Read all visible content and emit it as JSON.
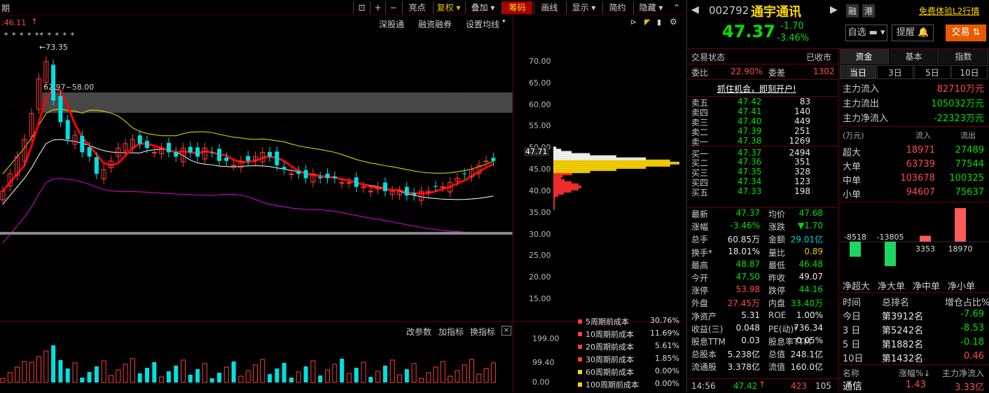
{
  "toolbar": {
    "period_left": "期",
    "buttons": [
      "亮点",
      "复权",
      "叠加",
      "筹码",
      "画线",
      "显示",
      "简约",
      "隐藏"
    ],
    "icons": [
      "lock-icon",
      "plus-icon",
      "minus-icon"
    ]
  },
  "chart_header": {
    "price_left": ":46.11",
    "marks": "* *  *   *  ** *  *   *   *",
    "links": [
      "深股通",
      "融资融券",
      "设置均线"
    ],
    "high_label": "73.35",
    "zone_label": "62.97~58.00"
  },
  "axis": {
    "ticks": [
      "70.00",
      "65.00",
      "60.00",
      "55.00",
      "50.00",
      "45.00",
      "40.00",
      "35.00",
      "30.00",
      "25.00",
      "20.00",
      "15.00"
    ],
    "current": "47.71"
  },
  "volume": {
    "links": [
      "改参数",
      "加指标",
      "换指标"
    ],
    "ticks": [
      "199.00",
      "99.40",
      "0.00"
    ]
  },
  "cost": [
    {
      "label": "5周期前成本",
      "value": "30.76%",
      "color": "#ff4040"
    },
    {
      "label": "10周期前成本",
      "value": "11.69%",
      "color": "#ff4040"
    },
    {
      "label": "20周期前成本",
      "value": "5.61%",
      "color": "#ff4040"
    },
    {
      "label": "30周期前成本",
      "value": "1.85%",
      "color": "#ff4040"
    },
    {
      "label": "60周期前成本",
      "value": "0.00%",
      "color": "#ffd700"
    },
    {
      "label": "100周期前成本",
      "value": "0.00%",
      "color": "#ffd700"
    }
  ],
  "stock": {
    "code": "002792",
    "name": "通宇通讯",
    "tags": [
      "融",
      "港"
    ],
    "trial": "免费体验L2行情",
    "price": "47.37",
    "change": "-1.70",
    "pct": "-3.46%",
    "btn_fav": "自选",
    "btn_alert": "提醒",
    "btn_trade": "交易"
  },
  "trade_status": {
    "label": "交易状态",
    "value": "已收市"
  },
  "ratio": {
    "wb_label": "委比",
    "wb": "22.90%",
    "wc_label": "委差",
    "wc": "1302"
  },
  "promo": "抓住机会，即刻开户!",
  "sell": [
    {
      "l": "卖五",
      "p": "47.42",
      "v": "83"
    },
    {
      "l": "卖四",
      "p": "47.41",
      "v": "140"
    },
    {
      "l": "卖三",
      "p": "47.40",
      "v": "449"
    },
    {
      "l": "卖二",
      "p": "47.39",
      "v": "251"
    },
    {
      "l": "卖一",
      "p": "47.38",
      "v": "1269"
    }
  ],
  "buy": [
    {
      "l": "买一",
      "p": "47.37",
      "v": "2494"
    },
    {
      "l": "买二",
      "p": "47.36",
      "v": "351"
    },
    {
      "l": "买三",
      "p": "47.35",
      "v": "328"
    },
    {
      "l": "买四",
      "p": "47.34",
      "v": "123"
    },
    {
      "l": "买五",
      "p": "47.33",
      "v": "198"
    }
  ],
  "stats": [
    {
      "l1": "最新",
      "v1": "47.37",
      "c1": "grn",
      "l2": "均价",
      "v2": "47.68",
      "c2": "grn"
    },
    {
      "l1": "涨幅",
      "v1": "-3.46%",
      "c1": "grn",
      "l2": "涨跌",
      "v2": "▼1.70",
      "c2": "grn"
    },
    {
      "l1": "总手",
      "v1": "60.85万",
      "c1": "wht",
      "l2": "金额",
      "v2": "29.01亿",
      "c2": "cyan"
    },
    {
      "l1": "换手*",
      "v1": "18.01%",
      "c1": "wht",
      "l2": "量比",
      "v2": "0.89",
      "c2": "yel"
    },
    {
      "l1": "最高",
      "v1": "48.87",
      "c1": "grn",
      "l2": "最低",
      "v2": "46.48",
      "c2": "grn"
    },
    {
      "l1": "今开",
      "v1": "47.50",
      "c1": "grn",
      "l2": "昨收",
      "v2": "49.07",
      "c2": "wht"
    },
    {
      "l1": "涨停",
      "v1": "53.98",
      "c1": "red",
      "l2": "跌停",
      "v2": "44.16",
      "c2": "grn"
    },
    {
      "l1": "外盘",
      "v1": "27.45万",
      "c1": "red",
      "l2": "内盘",
      "v2": "33.40万",
      "c2": "grn"
    },
    {
      "l1": "净资产",
      "v1": "5.31",
      "c1": "wht",
      "l2": "ROE",
      "v2": "1.00%",
      "c2": "wht"
    },
    {
      "l1": "收益(三)",
      "v1": "0.048",
      "c1": "wht",
      "l2": "PE(动)*",
      "v2": "736.34",
      "c2": "wht"
    },
    {
      "l1": "股息TTM",
      "v1": "0.03",
      "c1": "wht",
      "l2": "股息率TTM",
      "v2": "0.05%",
      "c2": "wht"
    },
    {
      "l1": "总股本",
      "v1": "5.238亿",
      "c1": "wht",
      "l2": "总值",
      "v2": "248.1亿",
      "c2": "wht"
    },
    {
      "l1": "流通股",
      "v1": "3.378亿",
      "c1": "wht",
      "l2": "流值",
      "v2": "160.0亿",
      "c2": "wht"
    }
  ],
  "tick": {
    "time": "14:56",
    "price": "47.42",
    "vol": "423",
    "extra": "105"
  },
  "tabs": [
    "资金",
    "基本",
    "指数"
  ],
  "subtabs": [
    "当日",
    "3日",
    "5日",
    "10日"
  ],
  "flow": [
    {
      "l": "主力流入",
      "v": "82710万元",
      "c": "red"
    },
    {
      "l": "主力流出",
      "v": "105032万元",
      "c": "grn"
    },
    {
      "l": "主力净流入",
      "v": "-22323万元",
      "c": "grn"
    }
  ],
  "flow_table": {
    "unit": "(万元)",
    "in": "流入",
    "out": "流出",
    "rows": [
      {
        "l": "超大",
        "i": "18971",
        "o": "27489"
      },
      {
        "l": "大单",
        "i": "63739",
        "o": "77544"
      },
      {
        "l": "中单",
        "i": "103678",
        "o": "100325"
      },
      {
        "l": "小单",
        "i": "94607",
        "o": "75637"
      }
    ]
  },
  "net_bars": {
    "labels": [
      "净超大",
      "净大单",
      "净中单",
      "净小单"
    ],
    "values": [
      -8518,
      -13805,
      3353,
      18970
    ],
    "texts": [
      "-8518",
      "-13805",
      "3353",
      "18970"
    ]
  },
  "rank": {
    "headers": [
      "时间",
      "总排名",
      "增仓占比%"
    ],
    "rows": [
      {
        "t": "今日",
        "r": "第3912名",
        "v": "-7.69"
      },
      {
        "t": "3 日",
        "r": "第5242名",
        "v": "-8.53"
      },
      {
        "t": "5 日",
        "r": "第1882名",
        "v": "-0.18"
      },
      {
        "t": "10日",
        "r": "第1432名",
        "v": "0.46"
      }
    ]
  },
  "sector": {
    "headers": [
      "名称",
      "涨幅%↓",
      "主力净流入"
    ],
    "row": {
      "n": "通信",
      "p": "1.43",
      "v": "3.33亿"
    }
  },
  "colors": {
    "up": "#ff3b3b",
    "down": "#00e0e0",
    "ma5": "#ffffff",
    "ma10": "#e6e600",
    "ma20": "#e000e0",
    "ma_main": "#ff0000"
  }
}
